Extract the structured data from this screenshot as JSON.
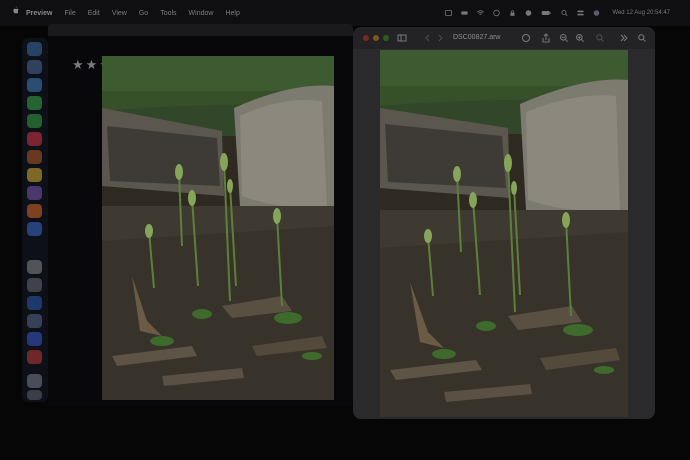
{
  "menubar": {
    "app_name": "Preview",
    "items": [
      "File",
      "Edit",
      "View",
      "Go",
      "Tools",
      "Window",
      "Help"
    ],
    "clock": "Wed 12 Aug 20:54:47"
  },
  "window_back": {
    "title": "",
    "rating": 3,
    "rating_max": 5
  },
  "window_front": {
    "title": "DSC00827.arw"
  },
  "colors": {
    "traffic_close": "#7a2a24",
    "traffic_minimize": "#7a5a1c",
    "traffic_zoom": "#2c5a24"
  }
}
